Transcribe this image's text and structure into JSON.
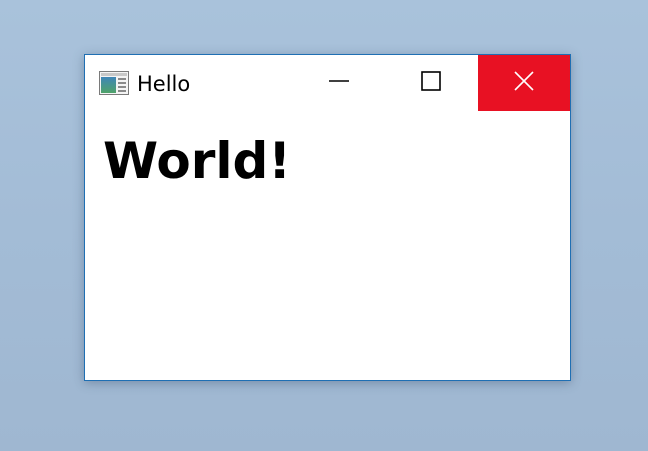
{
  "window": {
    "title": "Hello",
    "app_icon": "window-app-icon",
    "controls": {
      "minimize_icon": "minimize-icon",
      "maximize_icon": "maximize-icon",
      "close_icon": "close-icon",
      "close_hover_color": "#e81123"
    }
  },
  "content": {
    "heading": "World!"
  },
  "colors": {
    "desktop_background": "#a6bfd9",
    "window_border": "#1f6fb3",
    "window_background": "#ffffff"
  }
}
